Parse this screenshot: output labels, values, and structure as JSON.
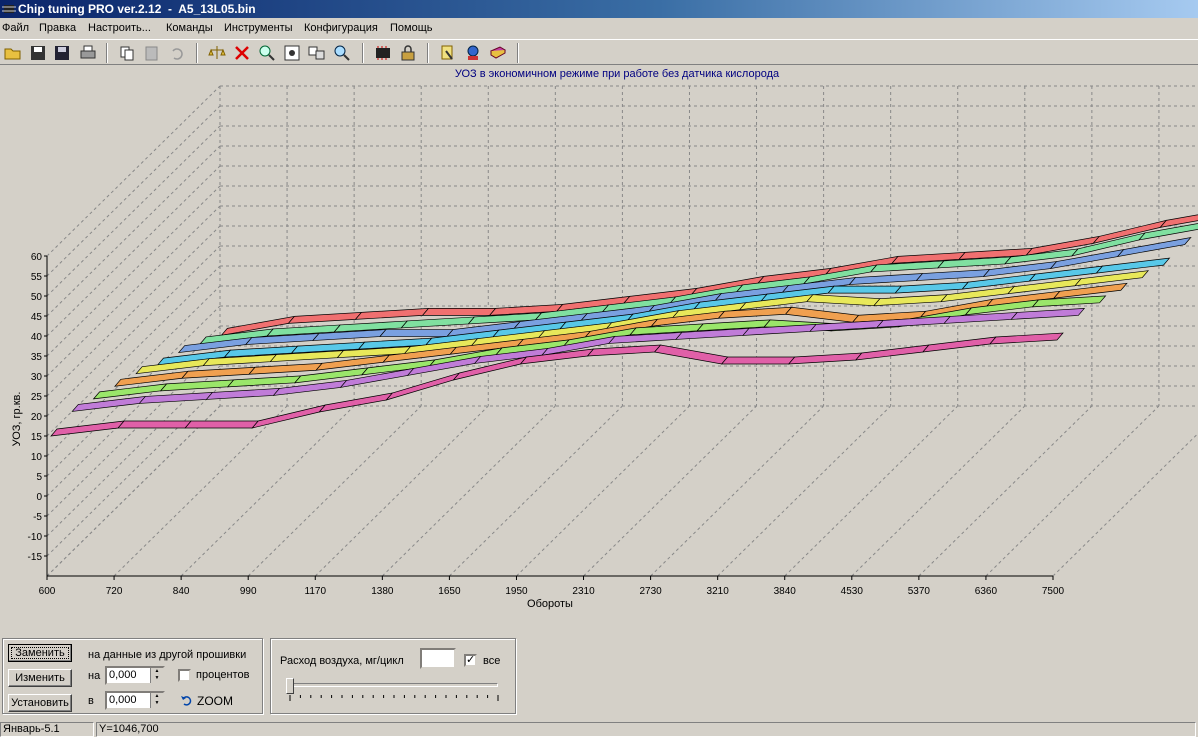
{
  "window": {
    "title": "Chip tuning PRO ver.2.12  -  A5_13L05.bin"
  },
  "menu": [
    "Файл",
    "Правка",
    "Настроить...",
    "Команды",
    "Инструменты",
    "Конфигурация",
    "Помощь"
  ],
  "toolbar": {
    "icons": [
      "open-folder-icon",
      "save-icon",
      "save-as-icon",
      "print-icon",
      "copy-icon",
      "paste-icon",
      "undo-icon",
      "scales-icon",
      "delete-icon",
      "zoom-icon",
      "view-icon",
      "compare-icon",
      "search-icon",
      "chip-icon",
      "lock-icon",
      "tools-icon",
      "info-icon",
      "book-icon"
    ]
  },
  "chart_data": {
    "type": "surface3d",
    "title": "УОЗ в экономичном режиме при работе без датчика кислорода",
    "xlabel": "Обороты",
    "ylabel": "УОЗ, гр.кв.",
    "x_ticks": [
      "600",
      "720",
      "840",
      "990",
      "1170",
      "1380",
      "1650",
      "1950",
      "2310",
      "2730",
      "3210",
      "3840",
      "4530",
      "5370",
      "6360",
      "7500"
    ],
    "y_ticks": [
      "60",
      "55",
      "50",
      "45",
      "40",
      "35",
      "30",
      "25",
      "20",
      "15",
      "10",
      "5",
      "0",
      "-5",
      "-10",
      "-15"
    ],
    "ylim": [
      -20,
      60
    ],
    "grid": true,
    "series": [
      {
        "values": [
          15,
          17,
          17,
          17,
          21,
          24,
          29,
          33,
          35,
          36,
          33,
          33,
          34,
          36,
          38,
          39
        ],
        "color": "#e060a8"
      },
      {
        "values": [
          20,
          22,
          23,
          24,
          26,
          29,
          32,
          34,
          37,
          38,
          39,
          40,
          41,
          42,
          43,
          44
        ],
        "color": "#c07cd8"
      },
      {
        "values": [
          22,
          24,
          25,
          26,
          28,
          30,
          33,
          35,
          38,
          39,
          40,
          39,
          40,
          43,
          45,
          46
        ],
        "color": "#9ae66a"
      },
      {
        "values": [
          24,
          26,
          27,
          28,
          30,
          32,
          34,
          36,
          39,
          41,
          42,
          40,
          41,
          44,
          46,
          48
        ],
        "color": "#f0a050"
      },
      {
        "values": [
          26,
          28,
          29,
          30,
          31,
          33,
          35,
          37,
          40,
          42,
          44,
          43,
          44,
          46,
          48,
          50
        ],
        "color": "#e8e85a"
      },
      {
        "values": [
          27,
          29,
          30,
          31,
          32,
          34,
          36,
          38,
          41,
          43,
          45,
          45,
          46,
          48,
          50,
          52
        ],
        "color": "#58c8e8"
      },
      {
        "values": [
          29,
          31,
          32,
          33,
          33,
          35,
          37,
          39,
          42,
          44,
          46,
          47,
          48,
          50,
          53,
          56
        ],
        "color": "#7aa0e0"
      },
      {
        "values": [
          30,
          32,
          33,
          34,
          35,
          36,
          38,
          40,
          43,
          45,
          48,
          49,
          50,
          52,
          56,
          59
        ],
        "color": "#80e0a0"
      },
      {
        "values": [
          31,
          34,
          35,
          36,
          36,
          37,
          39,
          41,
          44,
          46,
          49,
          50,
          51,
          54,
          58,
          61
        ],
        "color": "#f07070"
      }
    ]
  },
  "bottom": {
    "replace_button": "Заменить",
    "replace_note": "на данные из другой прошивки",
    "change_button": "Изменить",
    "set_button": "Установить",
    "na_label": "на",
    "na_value": "0,000",
    "v_label": "в",
    "v_value": "0,000",
    "percent_label": "процентов",
    "zoom_label": "ZOOM",
    "air_label": "Расход воздуха, мг/цикл",
    "air_value": "",
    "all_label": "все",
    "all_checked": "✓"
  },
  "status": {
    "left": "Январь-5.1",
    "right": "Y=1046,700"
  }
}
